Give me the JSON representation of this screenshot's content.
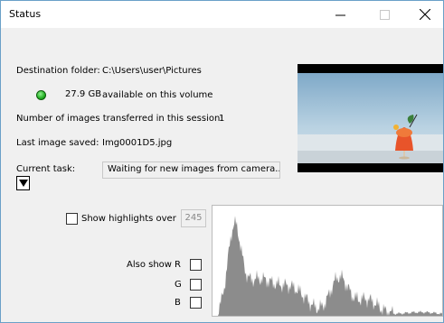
{
  "window": {
    "title": "Status",
    "minimize_icon": "minimize-icon",
    "maximize_icon": "maximize-icon",
    "close_icon": "close-icon"
  },
  "info": {
    "destination_label": "Destination folder:",
    "destination_path": "C:\\Users\\user\\Pictures",
    "free_space": "27.9 GB",
    "free_space_text": "available on this volume",
    "status_color": "#22b022",
    "transferred_label": "Number of images transferred in this session:",
    "transferred_count": "1",
    "last_saved_label": "Last image saved:",
    "last_saved_file": "Img0001D5.jpg"
  },
  "task": {
    "label": "Current task:",
    "value": "Waiting for new images from camera..."
  },
  "highlights": {
    "label": "Show highlights over",
    "value": "245"
  },
  "channels": {
    "also_show_label": "Also show",
    "r": "R",
    "g": "G",
    "b": "B"
  },
  "histogram_color": "#8c8c8c"
}
